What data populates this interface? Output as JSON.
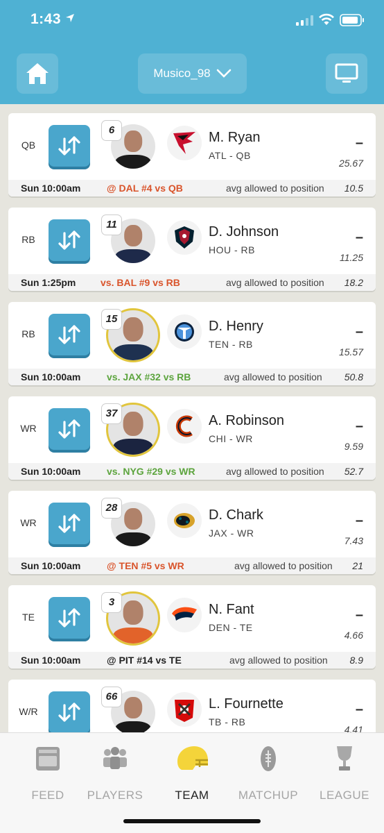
{
  "status": {
    "time": "1:43"
  },
  "header": {
    "username": "Musico_98",
    "home_icon": "home-icon",
    "tv_icon": "tv-icon",
    "dropdown_icon": "chevron-down-icon"
  },
  "colors": {
    "header": "#4fb1d3",
    "swap_button": "#4aa6cc",
    "red": "#d9542b",
    "green": "#5ca43d",
    "gold": "#e1c53c"
  },
  "roster": [
    {
      "slot": "QB",
      "jersey": "6",
      "name": "M. Ryan",
      "team_pos": "ATL - QB",
      "proj": "–",
      "points": "25.67",
      "game_time": "Sun 10:00am",
      "opponent": "@ DAL #4 vs QB",
      "opp_color": "red",
      "avg_label": "avg allowed to position",
      "avg_value": "10.5",
      "gold": false,
      "jersey_color": "#1a1a1a",
      "logo": "falcons-logo"
    },
    {
      "slot": "RB",
      "jersey": "11",
      "name": "D. Johnson",
      "team_pos": "HOU - RB",
      "proj": "–",
      "points": "11.25",
      "game_time": "Sun 1:25pm",
      "opponent": "vs. BAL #9 vs RB",
      "opp_color": "red",
      "avg_label": "avg allowed to position",
      "avg_value": "18.2",
      "gold": false,
      "jersey_color": "#1e2a4a",
      "logo": "texans-logo"
    },
    {
      "slot": "RB",
      "jersey": "15",
      "name": "D. Henry",
      "team_pos": "TEN - RB",
      "proj": "–",
      "points": "15.57",
      "game_time": "Sun 10:00am",
      "opponent": "vs. JAX #32 vs RB",
      "opp_color": "green",
      "avg_label": "avg allowed to position",
      "avg_value": "50.8",
      "gold": true,
      "jersey_color": "#1e3150",
      "logo": "titans-logo"
    },
    {
      "slot": "WR",
      "jersey": "37",
      "name": "A. Robinson",
      "team_pos": "CHI - WR",
      "proj": "–",
      "points": "9.59",
      "game_time": "Sun 10:00am",
      "opponent": "vs. NYG #29 vs WR",
      "opp_color": "green",
      "avg_label": "avg allowed to position",
      "avg_value": "52.7",
      "gold": true,
      "jersey_color": "#1b2440",
      "logo": "bears-logo"
    },
    {
      "slot": "WR",
      "jersey": "28",
      "name": "D. Chark",
      "team_pos": "JAX - WR",
      "proj": "–",
      "points": "7.43",
      "game_time": "Sun 10:00am",
      "opponent": "@ TEN #5 vs WR",
      "opp_color": "red",
      "avg_label": "avg allowed to position",
      "avg_value": "21",
      "gold": false,
      "jersey_color": "#1a1a1a",
      "logo": "jaguars-logo"
    },
    {
      "slot": "TE",
      "jersey": "3",
      "name": "N. Fant",
      "team_pos": "DEN - TE",
      "proj": "–",
      "points": "4.66",
      "game_time": "Sun 10:00am",
      "opponent": "@ PIT #14 vs TE",
      "opp_color": "black",
      "avg_label": "avg allowed to position",
      "avg_value": "8.9",
      "gold": true,
      "jersey_color": "#e2632a",
      "logo": "broncos-logo"
    },
    {
      "slot": "W/R",
      "jersey": "66",
      "name": "L. Fournette",
      "team_pos": "TB - RB",
      "proj": "–",
      "points": "4.41",
      "game_time": "",
      "opponent": "",
      "opp_color": "black",
      "avg_label": "",
      "avg_value": "",
      "gold": false,
      "jersey_color": "#1a1a1a",
      "logo": "buccaneers-logo"
    }
  ],
  "tabs": [
    {
      "label": "FEED",
      "icon": "feed-icon",
      "active": false
    },
    {
      "label": "PLAYERS",
      "icon": "players-icon",
      "active": false
    },
    {
      "label": "TEAM",
      "icon": "helmet-icon",
      "active": true
    },
    {
      "label": "MATCHUP",
      "icon": "football-icon",
      "active": false
    },
    {
      "label": "LEAGUE",
      "icon": "trophy-icon",
      "active": false
    }
  ]
}
